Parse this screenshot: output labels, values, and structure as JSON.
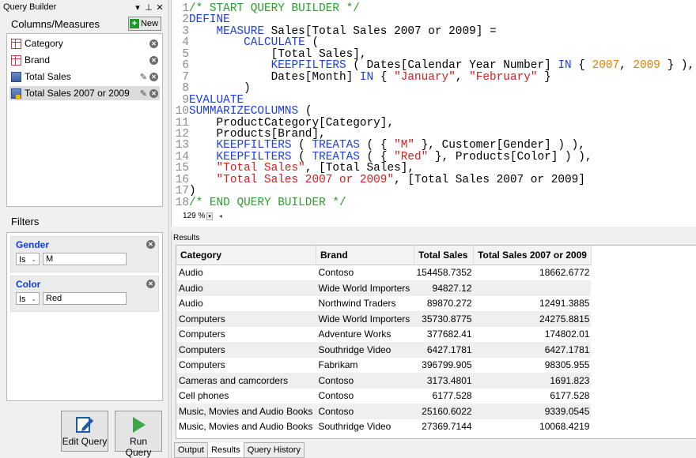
{
  "query_builder": {
    "title": "Query Builder",
    "columns_header": "Columns/Measures",
    "new_label": "New",
    "items": [
      {
        "label": "Category",
        "kind": "column"
      },
      {
        "label": "Brand",
        "kind": "column"
      },
      {
        "label": "Total Sales",
        "kind": "measure"
      },
      {
        "label": "Total Sales 2007 or 2009",
        "kind": "measure"
      }
    ],
    "filters_header": "Filters",
    "filters": [
      {
        "name": "Gender",
        "op": "Is",
        "value": "M"
      },
      {
        "name": "Color",
        "op": "Is",
        "value": "Red"
      }
    ],
    "edit_query_label": "Edit Query",
    "run_query_label": "Run Query"
  },
  "editor": {
    "zoom": "129 %",
    "lines": [
      [
        {
          "t": "/* START QUERY BUILDER */",
          "c": "cm"
        }
      ],
      [
        {
          "t": "DEFINE",
          "c": "kw"
        }
      ],
      [
        {
          "t": "    "
        },
        {
          "t": "MEASURE",
          "c": "kw"
        },
        {
          "t": " Sales[Total Sales 2007 or 2009] ="
        }
      ],
      [
        {
          "t": "        "
        },
        {
          "t": "CALCULATE",
          "c": "kw"
        },
        {
          "t": " ("
        }
      ],
      [
        {
          "t": "            [Total Sales],"
        }
      ],
      [
        {
          "t": "            "
        },
        {
          "t": "KEEPFILTERS",
          "c": "kw"
        },
        {
          "t": " ( Dates[Calendar Year Number] "
        },
        {
          "t": "IN",
          "c": "kw"
        },
        {
          "t": " { "
        },
        {
          "t": "2007",
          "c": "num"
        },
        {
          "t": ", "
        },
        {
          "t": "2009",
          "c": "num"
        },
        {
          "t": " } ),"
        }
      ],
      [
        {
          "t": "            Dates[Month] "
        },
        {
          "t": "IN",
          "c": "kw"
        },
        {
          "t": " { "
        },
        {
          "t": "\"January\"",
          "c": "str"
        },
        {
          "t": ", "
        },
        {
          "t": "\"February\"",
          "c": "str"
        },
        {
          "t": " }"
        }
      ],
      [
        {
          "t": "        )"
        }
      ],
      [
        {
          "t": "EVALUATE",
          "c": "kw"
        }
      ],
      [
        {
          "t": "SUMMARIZECOLUMNS",
          "c": "kw"
        },
        {
          "t": " ("
        }
      ],
      [
        {
          "t": "    ProductCategory[Category],"
        }
      ],
      [
        {
          "t": "    Products[Brand],"
        }
      ],
      [
        {
          "t": "    "
        },
        {
          "t": "KEEPFILTERS",
          "c": "kw"
        },
        {
          "t": " ( "
        },
        {
          "t": "TREATAS",
          "c": "kw"
        },
        {
          "t": " ( { "
        },
        {
          "t": "\"M\"",
          "c": "str"
        },
        {
          "t": " }, Customer[Gender] ) ),"
        }
      ],
      [
        {
          "t": "    "
        },
        {
          "t": "KEEPFILTERS",
          "c": "kw"
        },
        {
          "t": " ( "
        },
        {
          "t": "TREATAS",
          "c": "kw"
        },
        {
          "t": " ( { "
        },
        {
          "t": "\"Red\"",
          "c": "str"
        },
        {
          "t": " }, Products[Color] ) ),"
        }
      ],
      [
        {
          "t": "    "
        },
        {
          "t": "\"Total Sales\"",
          "c": "str"
        },
        {
          "t": ", [Total Sales],"
        }
      ],
      [
        {
          "t": "    "
        },
        {
          "t": "\"Total Sales 2007 or 2009\"",
          "c": "str"
        },
        {
          "t": ", [Total Sales 2007 or 2009]"
        }
      ],
      [
        {
          "t": ")"
        }
      ],
      [
        {
          "t": "/* END QUERY BUILDER */",
          "c": "cm"
        }
      ]
    ]
  },
  "results": {
    "title": "Results",
    "columns": [
      "Category",
      "Brand",
      "Total Sales",
      "Total Sales 2007 or 2009"
    ],
    "rows": [
      [
        "Audio",
        "Contoso",
        "154458.7352",
        "18662.6772"
      ],
      [
        "Audio",
        "Wide World Importers",
        "94827.12",
        ""
      ],
      [
        "Audio",
        "Northwind Traders",
        "89870.272",
        "12491.3885"
      ],
      [
        "Computers",
        "Wide World Importers",
        "35730.8775",
        "24275.8815"
      ],
      [
        "Computers",
        "Adventure Works",
        "377682.41",
        "174802.01"
      ],
      [
        "Computers",
        "Southridge Video",
        "6427.1781",
        "6427.1781"
      ],
      [
        "Computers",
        "Fabrikam",
        "396799.905",
        "98305.955"
      ],
      [
        "Cameras and camcorders",
        "Contoso",
        "3173.4801",
        "1691.823"
      ],
      [
        "Cell phones",
        "Contoso",
        "6177.528",
        "6177.528"
      ],
      [
        "Music, Movies and Audio Books",
        "Contoso",
        "25160.6022",
        "9339.0545"
      ],
      [
        "Music, Movies and Audio Books",
        "Southridge Video",
        "27369.7144",
        "10068.4219"
      ]
    ],
    "tabs": [
      "Output",
      "Results",
      "Query History"
    ],
    "active_tab": "Results"
  }
}
